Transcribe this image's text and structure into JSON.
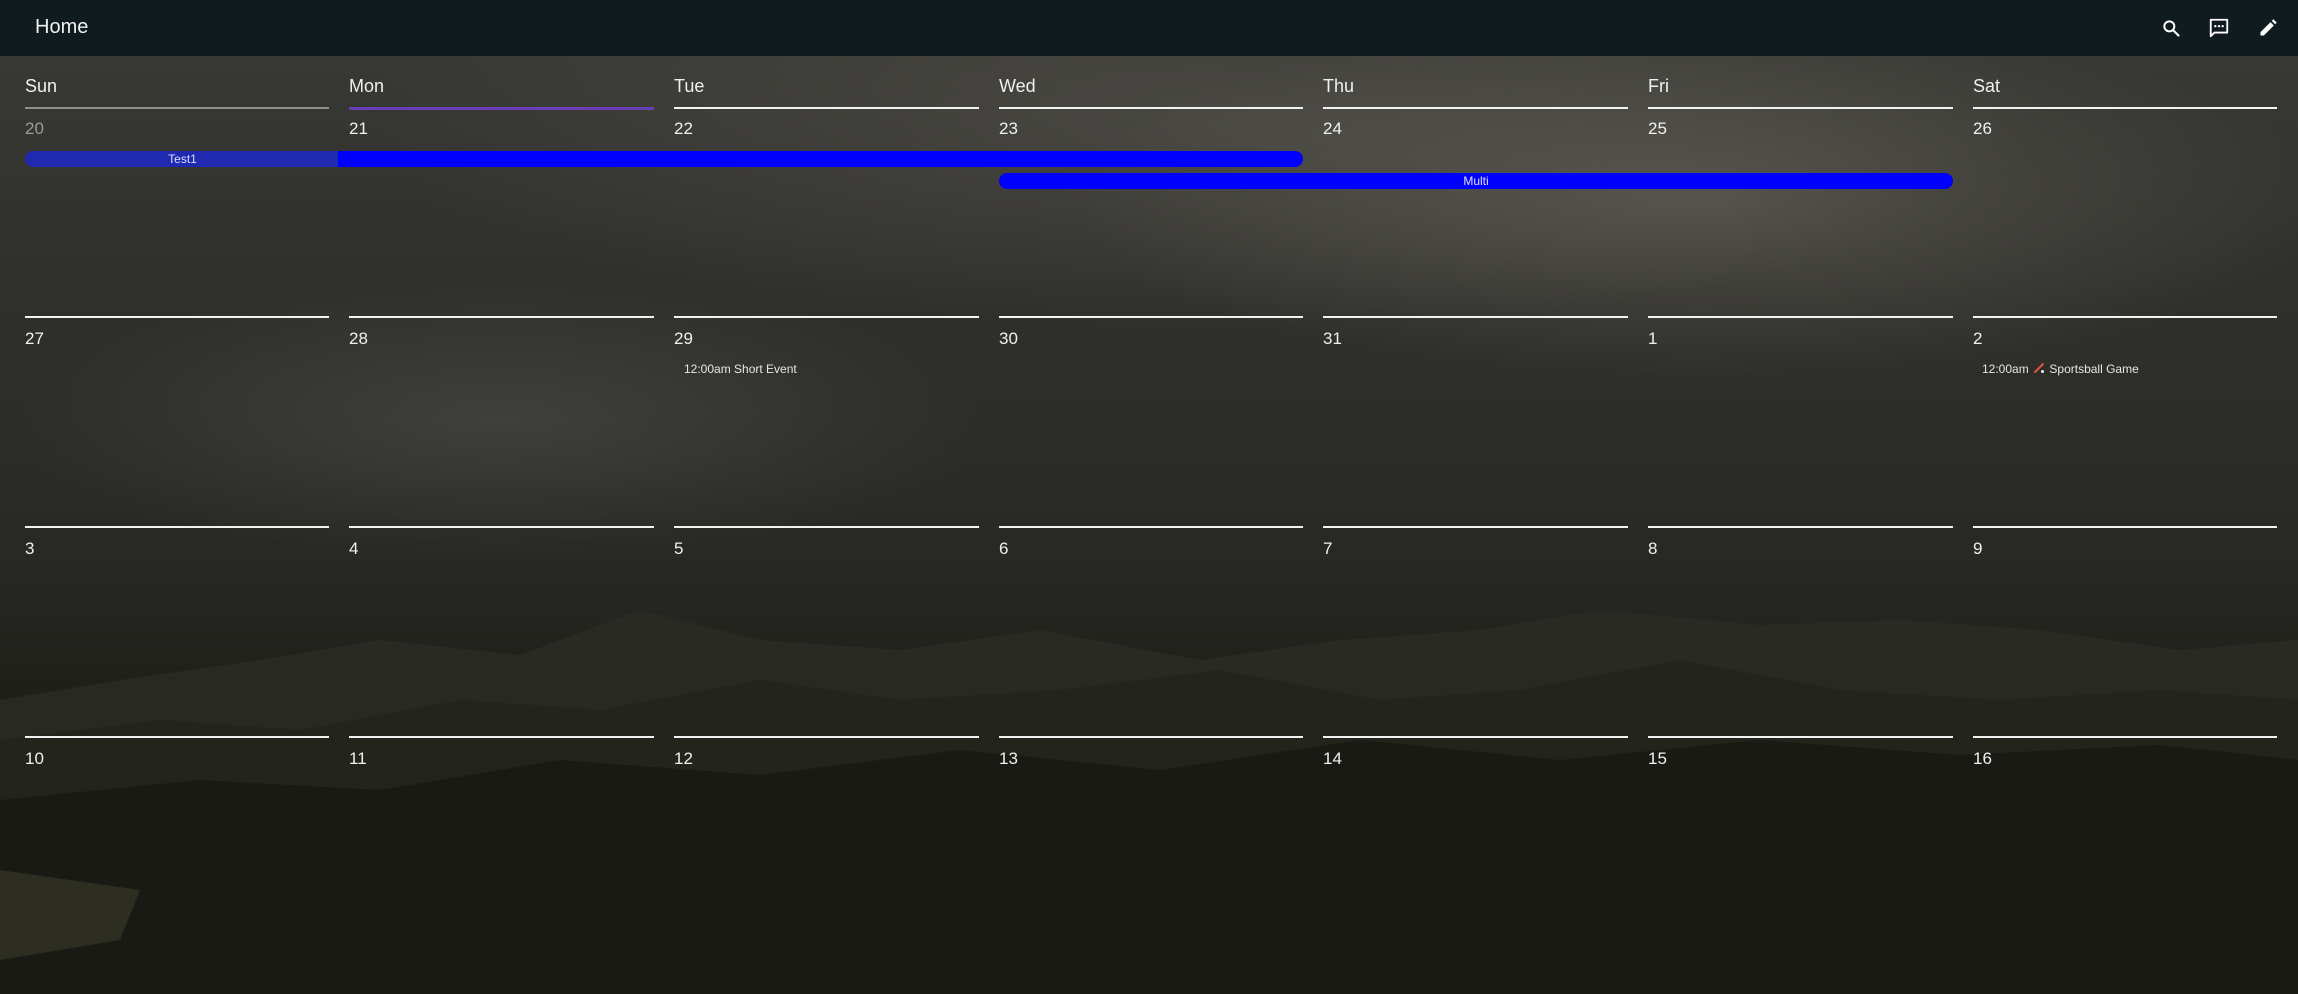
{
  "header": {
    "title": "Home",
    "icons": [
      "search-icon",
      "chat-icon",
      "edit-icon"
    ]
  },
  "colors": {
    "topbar": "#101b20",
    "today_underline": "#6a3fb3",
    "event_blue": "#0000ff",
    "event_dim": "#1f2ab0"
  },
  "calendar": {
    "weekdays": [
      "Sun",
      "Mon",
      "Tue",
      "Wed",
      "Thu",
      "Fri",
      "Sat"
    ],
    "today_index": 1,
    "weeks": [
      [
        "20",
        "21",
        "22",
        "23",
        "24",
        "25",
        "26"
      ],
      [
        "27",
        "28",
        "29",
        "30",
        "31",
        "1",
        "2"
      ],
      [
        "3",
        "4",
        "5",
        "6",
        "7",
        "8",
        "9"
      ],
      [
        "10",
        "11",
        "12",
        "13",
        "14",
        "15",
        "16"
      ]
    ],
    "events": {
      "test1": "Test1",
      "multi": "Multi",
      "short_event": "12:00am Short Event",
      "sportsball_time": "12:00am",
      "sportsball_title": "Sportsball Game"
    }
  }
}
